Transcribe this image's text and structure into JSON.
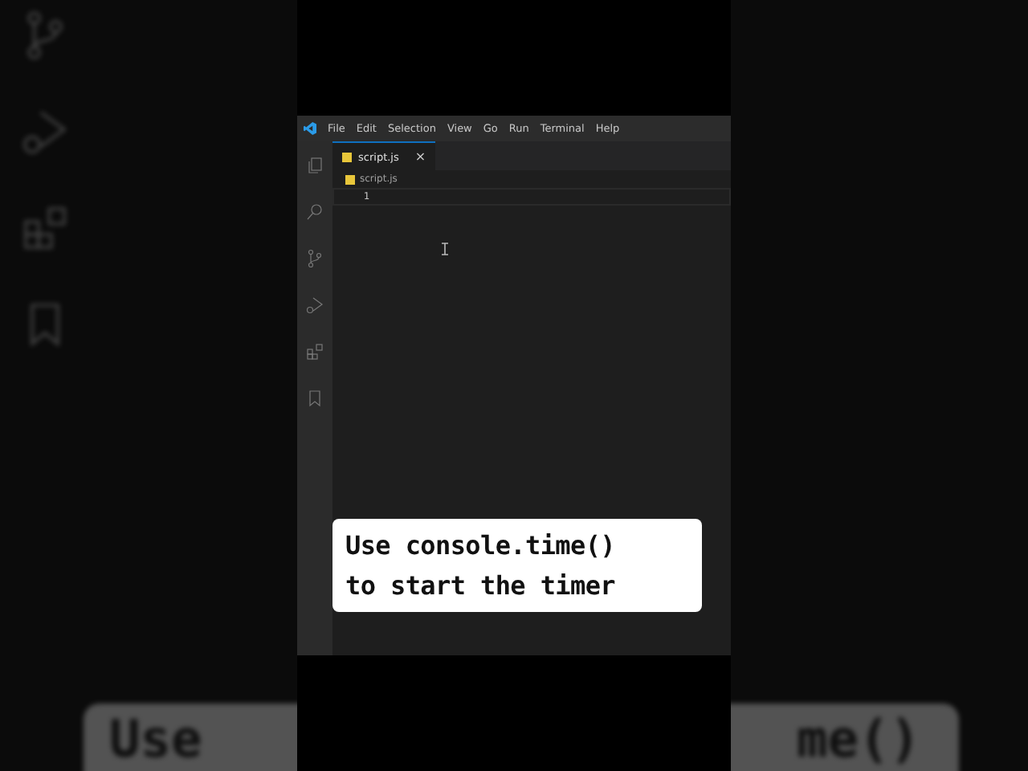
{
  "backdrop": {
    "caption_parts": [
      "Use",
      "me()"
    ]
  },
  "menu": [
    "File",
    "Edit",
    "Selection",
    "View",
    "Go",
    "Run",
    "Terminal",
    "Help"
  ],
  "activity_bar": [
    {
      "kind": "files",
      "selected": false
    },
    {
      "kind": "search",
      "selected": false
    },
    {
      "kind": "branch",
      "selected": false
    },
    {
      "kind": "debug",
      "selected": false
    },
    {
      "kind": "extensions",
      "selected": false
    },
    {
      "kind": "bookmark",
      "selected": false
    }
  ],
  "tabs": [
    {
      "label": "script.js",
      "selected": true,
      "close": "×"
    }
  ],
  "breadcrumb": "script.js",
  "lines": [
    "1"
  ],
  "caption": [
    "Use console.time()",
    "to start the timer"
  ]
}
